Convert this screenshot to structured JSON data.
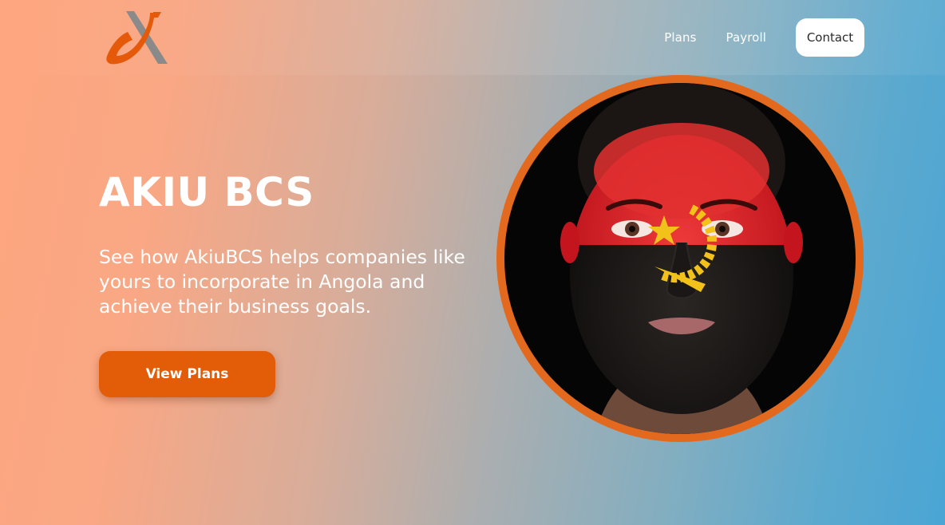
{
  "header": {
    "logo_icon": "akiu-logo-icon",
    "nav": {
      "plans_label": "Plans",
      "payroll_label": "Payroll",
      "contact_label": "Contact"
    }
  },
  "hero": {
    "title": "AKIU BCS",
    "subtitle": "See how AkiuBCS helps companies like yours to incorporate in Angola and achieve their business goals.",
    "cta_label": "View Plans",
    "image": "portrait-angola-flag-face-paint"
  },
  "colors": {
    "accent": "#e35c07",
    "gradient_start": "#fea67f",
    "gradient_end": "#4aa5d4",
    "flag_red": "#d4101e",
    "flag_black": "#111111",
    "flag_emblem": "#f5c518"
  }
}
